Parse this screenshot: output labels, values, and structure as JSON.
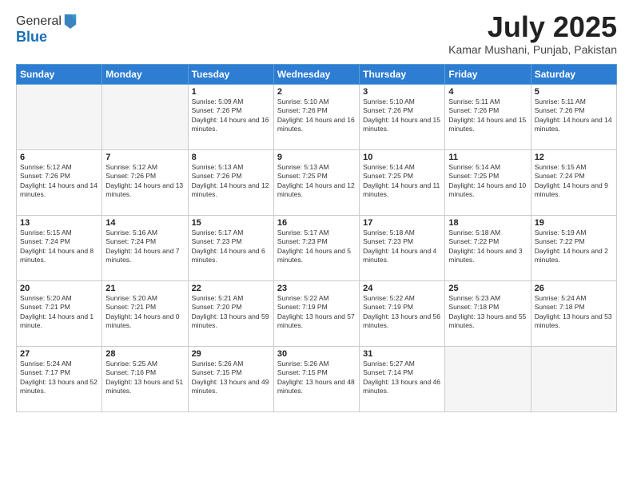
{
  "header": {
    "logo_general": "General",
    "logo_blue": "Blue",
    "month_title": "July 2025",
    "subtitle": "Kamar Mushani, Punjab, Pakistan"
  },
  "calendar": {
    "headers": [
      "Sunday",
      "Monday",
      "Tuesday",
      "Wednesday",
      "Thursday",
      "Friday",
      "Saturday"
    ],
    "weeks": [
      [
        {
          "day": "",
          "info": ""
        },
        {
          "day": "",
          "info": ""
        },
        {
          "day": "1",
          "info": "Sunrise: 5:09 AM\nSunset: 7:26 PM\nDaylight: 14 hours and 16 minutes."
        },
        {
          "day": "2",
          "info": "Sunrise: 5:10 AM\nSunset: 7:26 PM\nDaylight: 14 hours and 16 minutes."
        },
        {
          "day": "3",
          "info": "Sunrise: 5:10 AM\nSunset: 7:26 PM\nDaylight: 14 hours and 15 minutes."
        },
        {
          "day": "4",
          "info": "Sunrise: 5:11 AM\nSunset: 7:26 PM\nDaylight: 14 hours and 15 minutes."
        },
        {
          "day": "5",
          "info": "Sunrise: 5:11 AM\nSunset: 7:26 PM\nDaylight: 14 hours and 14 minutes."
        }
      ],
      [
        {
          "day": "6",
          "info": "Sunrise: 5:12 AM\nSunset: 7:26 PM\nDaylight: 14 hours and 14 minutes."
        },
        {
          "day": "7",
          "info": "Sunrise: 5:12 AM\nSunset: 7:26 PM\nDaylight: 14 hours and 13 minutes."
        },
        {
          "day": "8",
          "info": "Sunrise: 5:13 AM\nSunset: 7:26 PM\nDaylight: 14 hours and 12 minutes."
        },
        {
          "day": "9",
          "info": "Sunrise: 5:13 AM\nSunset: 7:25 PM\nDaylight: 14 hours and 12 minutes."
        },
        {
          "day": "10",
          "info": "Sunrise: 5:14 AM\nSunset: 7:25 PM\nDaylight: 14 hours and 11 minutes."
        },
        {
          "day": "11",
          "info": "Sunrise: 5:14 AM\nSunset: 7:25 PM\nDaylight: 14 hours and 10 minutes."
        },
        {
          "day": "12",
          "info": "Sunrise: 5:15 AM\nSunset: 7:24 PM\nDaylight: 14 hours and 9 minutes."
        }
      ],
      [
        {
          "day": "13",
          "info": "Sunrise: 5:15 AM\nSunset: 7:24 PM\nDaylight: 14 hours and 8 minutes."
        },
        {
          "day": "14",
          "info": "Sunrise: 5:16 AM\nSunset: 7:24 PM\nDaylight: 14 hours and 7 minutes."
        },
        {
          "day": "15",
          "info": "Sunrise: 5:17 AM\nSunset: 7:23 PM\nDaylight: 14 hours and 6 minutes."
        },
        {
          "day": "16",
          "info": "Sunrise: 5:17 AM\nSunset: 7:23 PM\nDaylight: 14 hours and 5 minutes."
        },
        {
          "day": "17",
          "info": "Sunrise: 5:18 AM\nSunset: 7:23 PM\nDaylight: 14 hours and 4 minutes."
        },
        {
          "day": "18",
          "info": "Sunrise: 5:18 AM\nSunset: 7:22 PM\nDaylight: 14 hours and 3 minutes."
        },
        {
          "day": "19",
          "info": "Sunrise: 5:19 AM\nSunset: 7:22 PM\nDaylight: 14 hours and 2 minutes."
        }
      ],
      [
        {
          "day": "20",
          "info": "Sunrise: 5:20 AM\nSunset: 7:21 PM\nDaylight: 14 hours and 1 minute."
        },
        {
          "day": "21",
          "info": "Sunrise: 5:20 AM\nSunset: 7:21 PM\nDaylight: 14 hours and 0 minutes."
        },
        {
          "day": "22",
          "info": "Sunrise: 5:21 AM\nSunset: 7:20 PM\nDaylight: 13 hours and 59 minutes."
        },
        {
          "day": "23",
          "info": "Sunrise: 5:22 AM\nSunset: 7:19 PM\nDaylight: 13 hours and 57 minutes."
        },
        {
          "day": "24",
          "info": "Sunrise: 5:22 AM\nSunset: 7:19 PM\nDaylight: 13 hours and 56 minutes."
        },
        {
          "day": "25",
          "info": "Sunrise: 5:23 AM\nSunset: 7:18 PM\nDaylight: 13 hours and 55 minutes."
        },
        {
          "day": "26",
          "info": "Sunrise: 5:24 AM\nSunset: 7:18 PM\nDaylight: 13 hours and 53 minutes."
        }
      ],
      [
        {
          "day": "27",
          "info": "Sunrise: 5:24 AM\nSunset: 7:17 PM\nDaylight: 13 hours and 52 minutes."
        },
        {
          "day": "28",
          "info": "Sunrise: 5:25 AM\nSunset: 7:16 PM\nDaylight: 13 hours and 51 minutes."
        },
        {
          "day": "29",
          "info": "Sunrise: 5:26 AM\nSunset: 7:15 PM\nDaylight: 13 hours and 49 minutes."
        },
        {
          "day": "30",
          "info": "Sunrise: 5:26 AM\nSunset: 7:15 PM\nDaylight: 13 hours and 48 minutes."
        },
        {
          "day": "31",
          "info": "Sunrise: 5:27 AM\nSunset: 7:14 PM\nDaylight: 13 hours and 46 minutes."
        },
        {
          "day": "",
          "info": ""
        },
        {
          "day": "",
          "info": ""
        }
      ]
    ]
  }
}
